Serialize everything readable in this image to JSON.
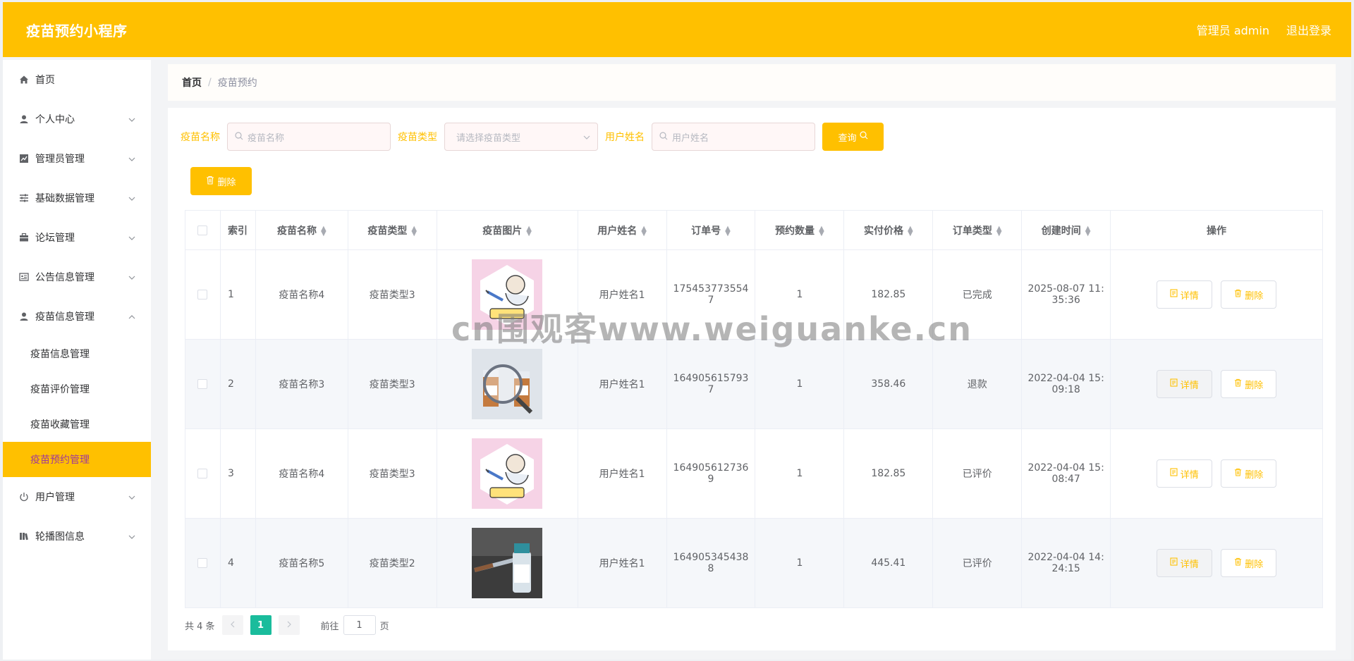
{
  "header": {
    "title": "疫苗预约小程序",
    "user_label": "管理员 admin",
    "logout_label": "退出登录"
  },
  "sidebar": {
    "items": [
      {
        "label": "首页",
        "icon": "home-icon",
        "expanded": false
      },
      {
        "label": "个人中心",
        "icon": "user-icon",
        "expanded": false
      },
      {
        "label": "管理员管理",
        "icon": "chart-icon",
        "expanded": false
      },
      {
        "label": "基础数据管理",
        "icon": "sliders-icon",
        "expanded": false
      },
      {
        "label": "论坛管理",
        "icon": "briefcase-icon",
        "expanded": false
      },
      {
        "label": "公告信息管理",
        "icon": "id-card-icon",
        "expanded": false
      },
      {
        "label": "疫苗信息管理",
        "icon": "user-icon",
        "expanded": true
      },
      {
        "label": "用户管理",
        "icon": "power-icon",
        "expanded": false
      },
      {
        "label": "轮播图信息",
        "icon": "books-icon",
        "expanded": false
      }
    ],
    "sub_items": [
      {
        "label": "疫苗信息管理",
        "active": false
      },
      {
        "label": "疫苗评价管理",
        "active": false
      },
      {
        "label": "疫苗收藏管理",
        "active": false
      },
      {
        "label": "疫苗预约管理",
        "active": true
      }
    ]
  },
  "breadcrumb": {
    "home": "首页",
    "separator": "/",
    "current": "疫苗预约"
  },
  "search": {
    "name_label": "疫苗名称",
    "name_placeholder": "疫苗名称",
    "type_label": "疫苗类型",
    "type_placeholder": "请选择疫苗类型",
    "user_label": "用户姓名",
    "user_placeholder": "用户姓名",
    "query_button": "查询"
  },
  "toolbar": {
    "delete_button": "删除"
  },
  "table": {
    "columns": [
      "索引",
      "疫苗名称",
      "疫苗类型",
      "疫苗图片",
      "用户姓名",
      "订单号",
      "预约数量",
      "实付价格",
      "订单类型",
      "创建时间",
      "操作"
    ],
    "rows": [
      {
        "index": "1",
        "name": "疫苗名称4",
        "type": "疫苗类型3",
        "image": "vaccine-poster",
        "user": "用户姓名1",
        "order_line1": "175453773554",
        "order_line2": "7",
        "qty": "1",
        "price": "182.85",
        "status": "已完成",
        "time_line1": "2025-08-07 11:",
        "time_line2": "35:36"
      },
      {
        "index": "2",
        "name": "疫苗名称3",
        "type": "疫苗类型3",
        "image": "magnifier-vials",
        "user": "用户姓名1",
        "order_line1": "164905615793",
        "order_line2": "7",
        "qty": "1",
        "price": "358.46",
        "status": "退款",
        "time_line1": "2022-04-04 15:",
        "time_line2": "09:18"
      },
      {
        "index": "3",
        "name": "疫苗名称4",
        "type": "疫苗类型3",
        "image": "vaccine-poster",
        "user": "用户姓名1",
        "order_line1": "164905612736",
        "order_line2": "9",
        "qty": "1",
        "price": "182.85",
        "status": "已评价",
        "time_line1": "2022-04-04 15:",
        "time_line2": "08:47"
      },
      {
        "index": "4",
        "name": "疫苗名称5",
        "type": "疫苗类型2",
        "image": "vial-syringe",
        "user": "用户姓名1",
        "order_line1": "164905345438",
        "order_line2": "8",
        "qty": "1",
        "price": "445.41",
        "status": "已评价",
        "time_line1": "2022-04-04 14:",
        "time_line2": "24:15"
      }
    ],
    "detail_button": "详情",
    "delete_button": "删除"
  },
  "pagination": {
    "total": "共 4 条",
    "current_page": "1",
    "goto_label": "前往",
    "goto_value": "1",
    "page_suffix": "页"
  },
  "watermark": "cn围观客www.weiguanke.cn",
  "colors": {
    "accent": "#ffc000",
    "page_active": "#1abc9c",
    "submenu_active_text": "#a03a9a"
  }
}
